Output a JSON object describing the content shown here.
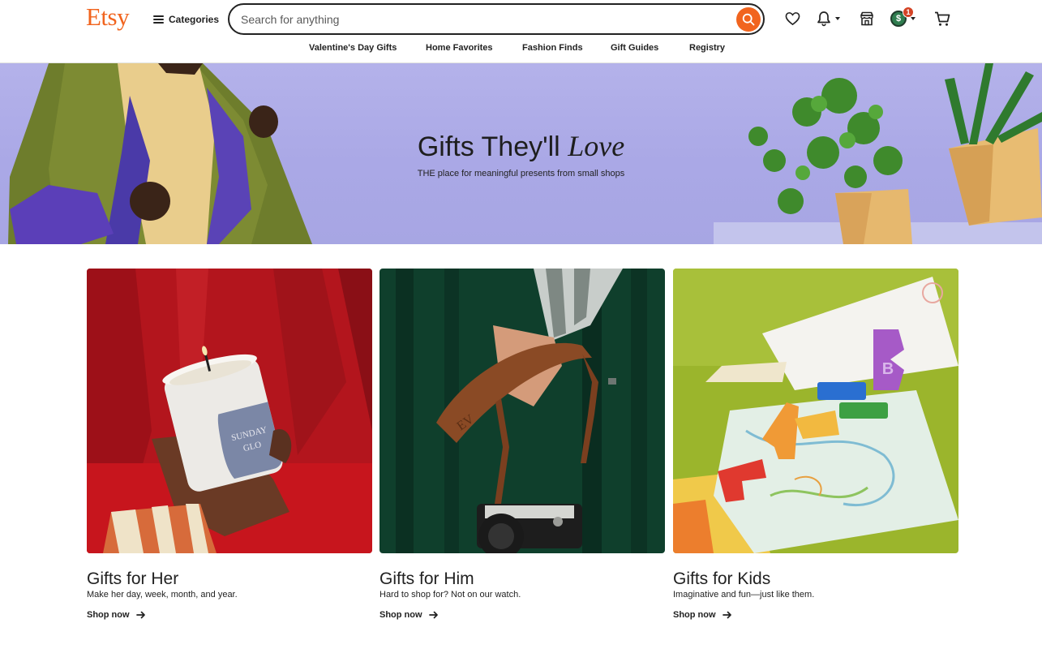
{
  "header": {
    "logo": "Etsy",
    "categories_label": "Categories",
    "search": {
      "placeholder": "Search for anything",
      "value": ""
    },
    "notification_badge": "1",
    "avatar_initial": "$"
  },
  "nav": {
    "items": [
      {
        "label": "Valentine's Day Gifts"
      },
      {
        "label": "Home Favorites"
      },
      {
        "label": "Fashion Finds"
      },
      {
        "label": "Gift Guides"
      },
      {
        "label": "Registry"
      }
    ]
  },
  "hero": {
    "title_main": "Gifts They'll",
    "title_italic": "Love",
    "subtitle": "THE place for meaningful presents from small shops"
  },
  "cards": [
    {
      "title": "Gifts for Her",
      "subtitle": "Make her day, week, month, and year.",
      "link": "Shop now",
      "candle_label": "SUNDAY GLO"
    },
    {
      "title": "Gifts for Him",
      "subtitle": "Hard to shop for? Not on our watch.",
      "link": "Shop now",
      "strap_monogram": "EV"
    },
    {
      "title": "Gifts for Kids",
      "subtitle": "Imaginative and fun—just like them.",
      "link": "Shop now",
      "crayon_letter": "B"
    }
  ],
  "colors": {
    "brand": "#f1641e",
    "hero_bg": "#aaa8e6",
    "text": "#222222",
    "badge": "#d44325"
  }
}
